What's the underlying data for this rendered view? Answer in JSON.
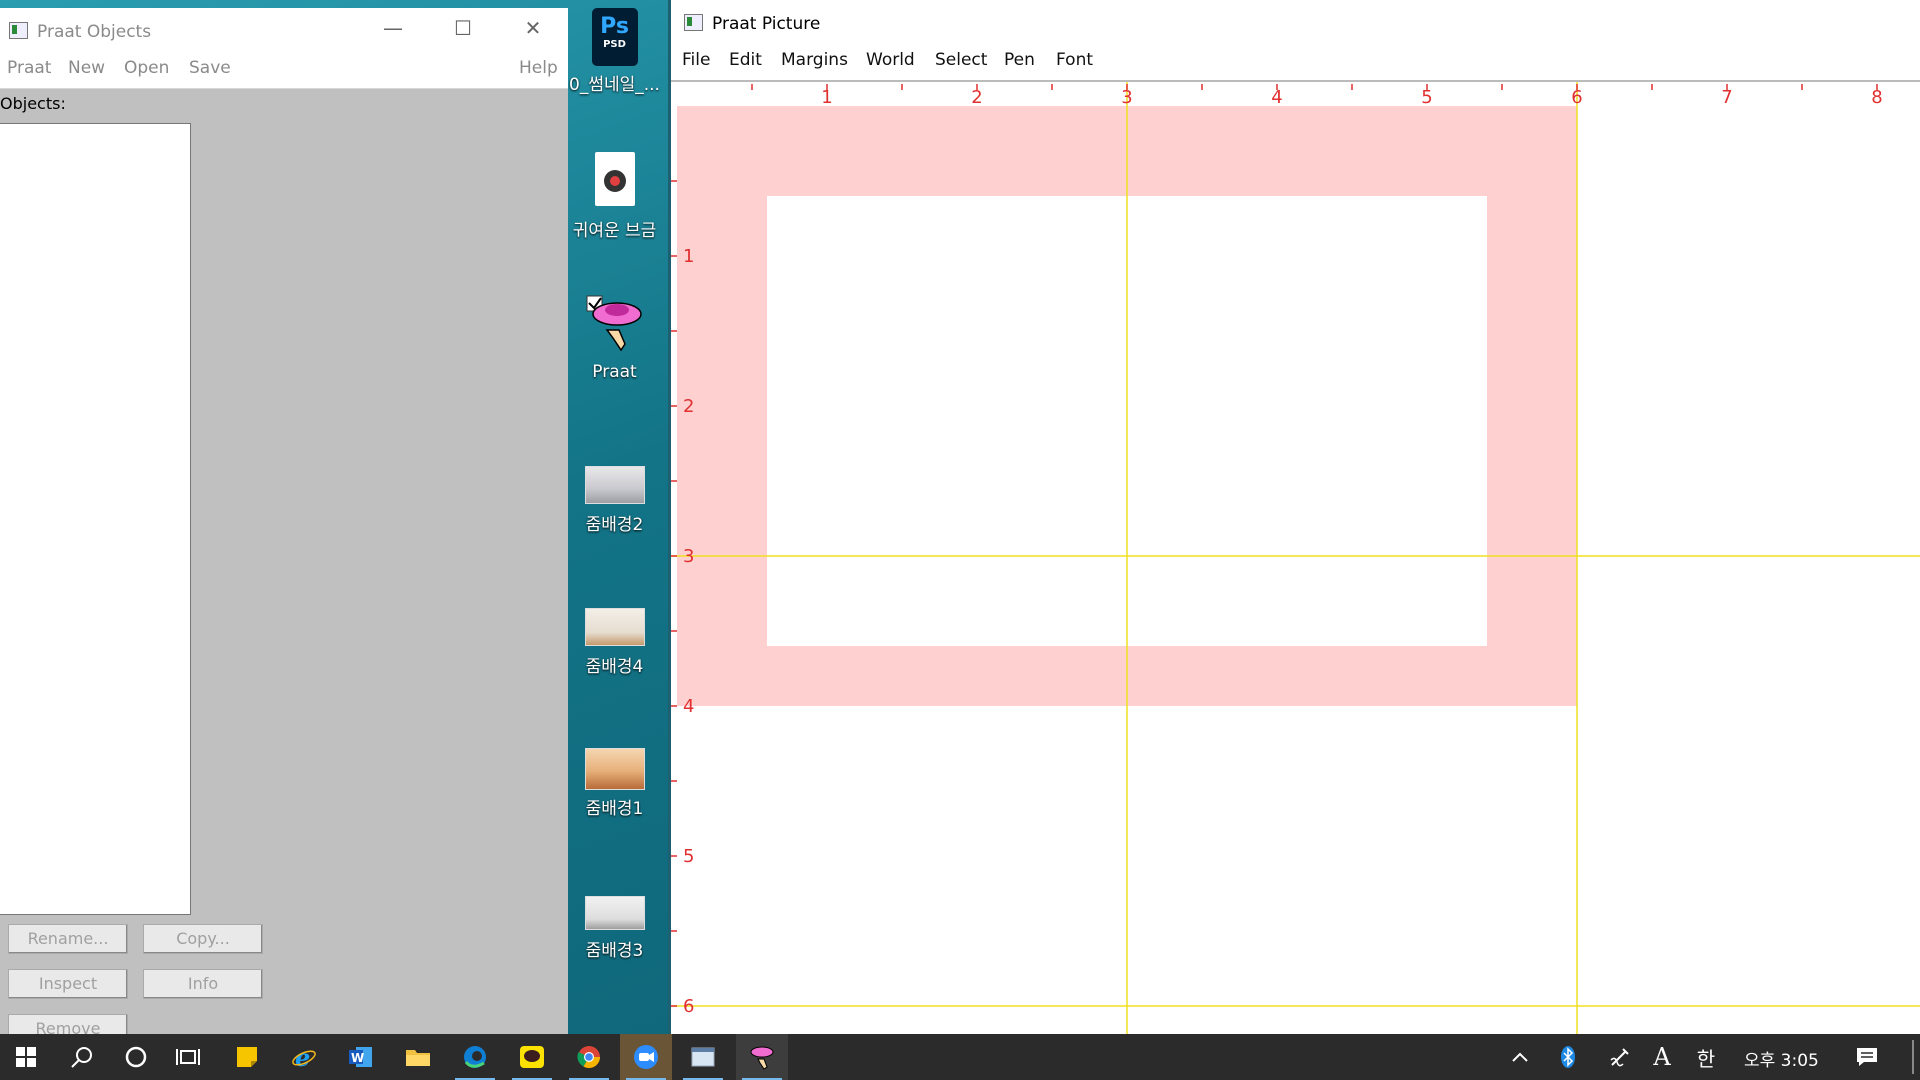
{
  "objects_window": {
    "title": "Praat Objects",
    "caption_buttons": {
      "minimize": "—",
      "maximize": "☐",
      "close": "✕"
    },
    "menu": [
      "Praat",
      "New",
      "Open",
      "Save",
      "Help"
    ],
    "objects_label": "Objects:",
    "buttons": {
      "rename": "Rename...",
      "copy": "Copy...",
      "inspect": "Inspect",
      "info": "Info",
      "remove": "Remove"
    }
  },
  "desktop_icons": [
    {
      "name": "psd-file-icon",
      "label": "0_썸네일_...",
      "badge_top": "Ps",
      "badge_bottom": "PSD"
    },
    {
      "name": "music-file-icon",
      "label": "귀여운 브금"
    },
    {
      "name": "praat-app-icon",
      "label": "Praat"
    },
    {
      "name": "image-thumbnail-icon",
      "label": "줌배경2"
    },
    {
      "name": "image-thumbnail-icon",
      "label": "줌배경4"
    },
    {
      "name": "image-thumbnail-icon",
      "label": "줌배경1"
    },
    {
      "name": "image-thumbnail-icon",
      "label": "줌배경3"
    }
  ],
  "picture_window": {
    "title": "Praat Picture",
    "menu": [
      "File",
      "Edit",
      "Margins",
      "World",
      "Select",
      "Pen",
      "Font"
    ],
    "ruler": {
      "x_labels": [
        "1",
        "2",
        "3",
        "4",
        "5",
        "6",
        "7",
        "8"
      ],
      "y_labels": [
        "1",
        "2",
        "3",
        "4",
        "5",
        "6"
      ]
    },
    "colors": {
      "ruler": "#e03030",
      "selection_fill": "#ffd0d0",
      "guide_lines": "#f0e020"
    },
    "selection_inches": {
      "x": [
        0,
        6
      ],
      "y": [
        0,
        4
      ]
    },
    "viewport_inches": {
      "x": [
        0.6,
        5.4
      ],
      "y": [
        0.6,
        3.6
      ]
    },
    "guide_lines_inches": {
      "x": [
        3,
        6
      ],
      "y": [
        3,
        6
      ]
    }
  },
  "taskbar": {
    "items": [
      "start-icon",
      "search-icon",
      "cortana-icon",
      "task-view-icon",
      "sticky-notes-icon",
      "internet-explorer-icon",
      "word-icon",
      "file-explorer-icon",
      "edge-icon",
      "kakaotalk-icon",
      "chrome-icon",
      "zoom-icon",
      "window-app-icon",
      "praat-taskbar-icon"
    ],
    "tray": {
      "time": "오후 3:05",
      "ime_mode": "A",
      "ime_lang": "한"
    }
  }
}
